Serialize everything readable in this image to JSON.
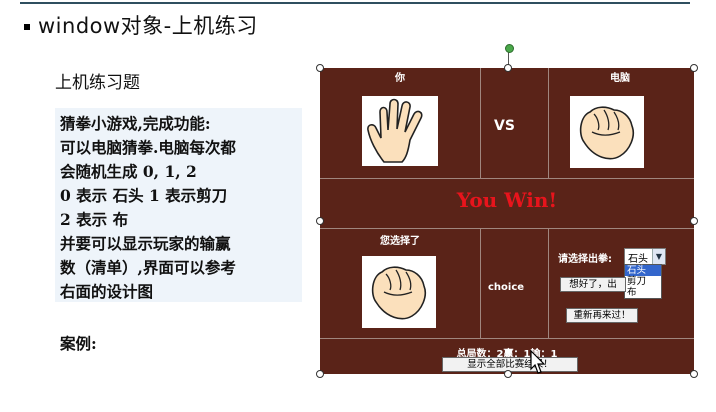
{
  "slide": {
    "title": "window对象-上机练习",
    "subheading": "上机练习题",
    "description_lines": [
      "猜拳小游戏,完成功能:",
      "可以电脑猜拳.电脑每次都",
      "会随机生成 0, 1, 2",
      "0 表示 石头 1 表示剪刀",
      "2 表示 布",
      "并要可以显示玩家的输赢",
      "数（清单）,界面可以参考",
      "右面的设计图"
    ],
    "example_label": "案例:"
  },
  "game": {
    "you_label": "你",
    "computer_label": "电脑",
    "vs_label": "VS",
    "result": "You Win!",
    "you_chose_label": "您选择了",
    "choice_label": "choice",
    "select_prompt": "请选择出拳:",
    "selected_option": "石头",
    "options": [
      "石头",
      "剪刀",
      "布"
    ],
    "confirm_button": "想好了，出",
    "restart_button": "重新再来过！",
    "summary": "总局数：2赢：1输：1",
    "show_all_button": "显示全部比赛结果！",
    "colors": {
      "board": "#5a2318",
      "result": "#e8141c"
    }
  }
}
